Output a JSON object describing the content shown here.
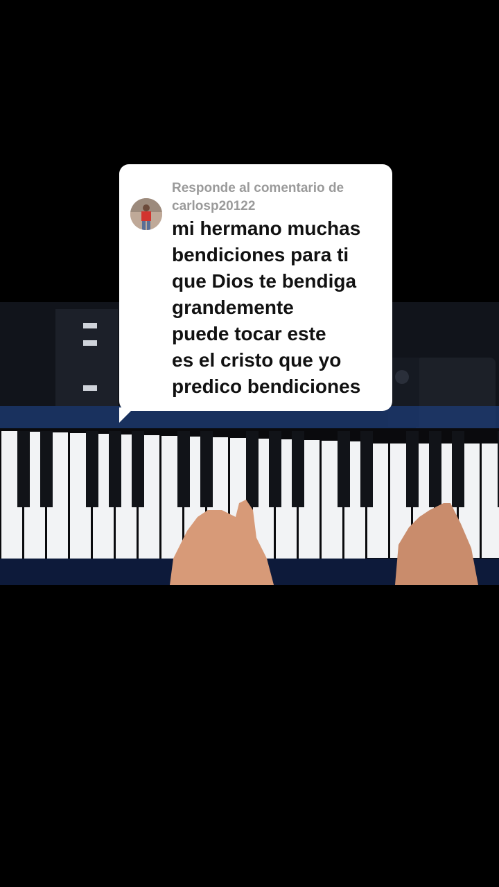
{
  "reply_card": {
    "header_prefix": "Responde al comentario de",
    "username": "carlosp20122",
    "comment": "mi hermano muchas\nbendiciones para ti\nque Dios te bendiga\ngrandemente\npuede tocar este\nes el cristo que yo\npredico bendiciones"
  },
  "icons": {
    "avatar": "commenter-avatar"
  },
  "colors": {
    "background": "#000000",
    "card": "#ffffff",
    "header_text": "#9a9a9a",
    "comment_text": "#111111"
  }
}
